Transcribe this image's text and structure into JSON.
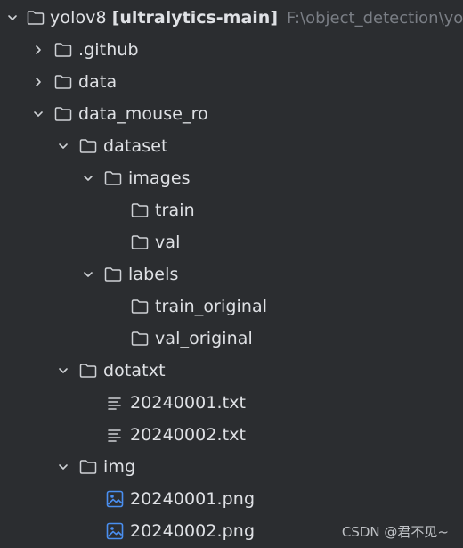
{
  "colors": {
    "background": "#2b2d30",
    "text": "#dfe1e5",
    "muted": "#7a7e85",
    "image_icon": "#4a8ff0"
  },
  "root": {
    "name": "yolov8",
    "project": "[ultralytics-main]",
    "path": "F:\\object_detection\\yo",
    "expanded": true
  },
  "items": [
    {
      "label": ".github",
      "type": "folder",
      "expanded": false
    },
    {
      "label": "data",
      "type": "folder",
      "expanded": false
    },
    {
      "label": "data_mouse_ro",
      "type": "folder",
      "expanded": true
    },
    {
      "label": "dataset",
      "type": "folder",
      "expanded": true
    },
    {
      "label": "images",
      "type": "folder",
      "expanded": true
    },
    {
      "label": "train",
      "type": "folder"
    },
    {
      "label": "val",
      "type": "folder"
    },
    {
      "label": "labels",
      "type": "folder",
      "expanded": true
    },
    {
      "label": "train_original",
      "type": "folder"
    },
    {
      "label": "val_original",
      "type": "folder"
    },
    {
      "label": "dotatxt",
      "type": "folder",
      "expanded": true
    },
    {
      "label": "20240001.txt",
      "type": "text-file"
    },
    {
      "label": "20240002.txt",
      "type": "text-file"
    },
    {
      "label": "img",
      "type": "folder",
      "expanded": true
    },
    {
      "label": "20240001.png",
      "type": "image-file"
    },
    {
      "label": "20240002.png",
      "type": "image-file"
    }
  ],
  "watermark": "CSDN @君不见~"
}
